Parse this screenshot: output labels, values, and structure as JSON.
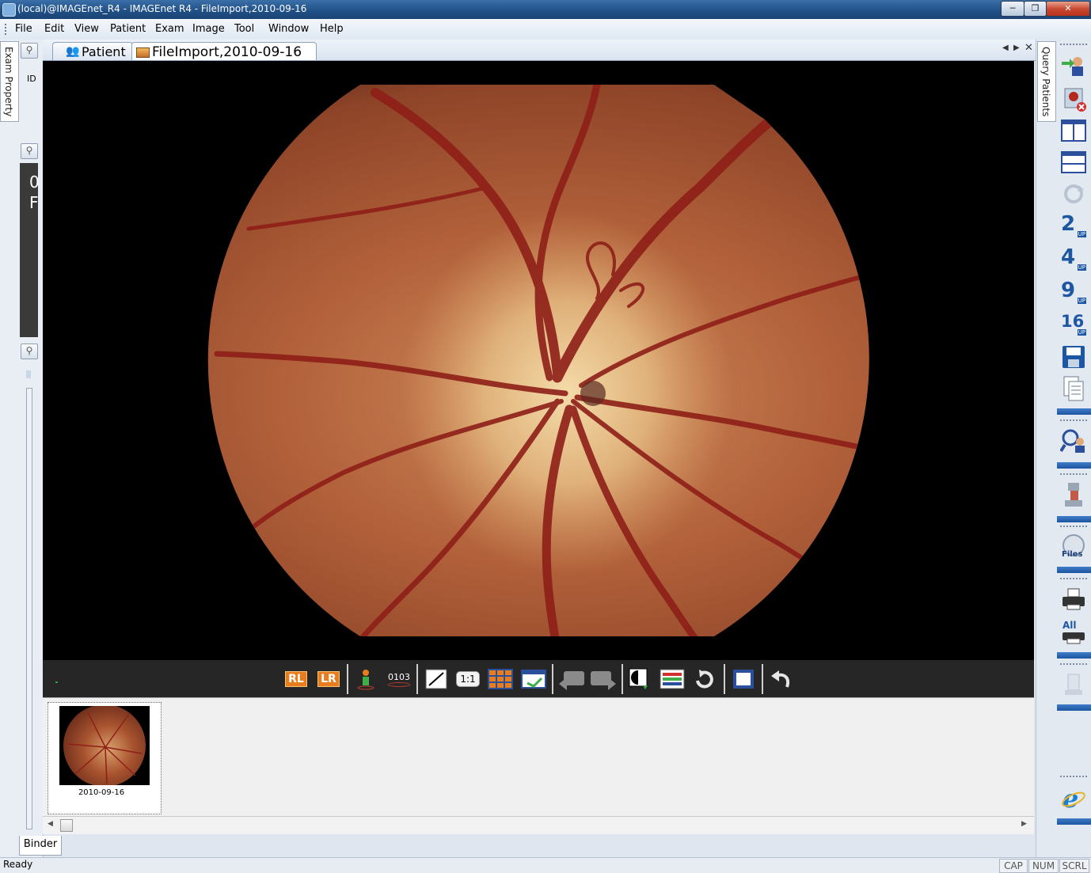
{
  "window": {
    "title": "(local)@IMAGEnet_R4 - IMAGEnet R4 - FileImport,2010-09-16",
    "controls": [
      "minimize-icon",
      "maximize-icon",
      "close-icon"
    ]
  },
  "menubar": {
    "items": [
      {
        "label": "File"
      },
      {
        "label": "Edit"
      },
      {
        "label": "View"
      },
      {
        "label": "Patient"
      },
      {
        "label": "Exam"
      },
      {
        "label": "Image"
      },
      {
        "label": "Tool"
      },
      {
        "label": "Window"
      },
      {
        "label": "Help"
      }
    ]
  },
  "left_dock": {
    "exam_property_tab": "Exam Property",
    "id_label": "ID",
    "info_line_1": "0",
    "info_line_2": "F"
  },
  "document_tabs": [
    {
      "label": "Patient",
      "icon": "patient-icon"
    },
    {
      "label": "FileImport,2010-09-16",
      "icon": "image-icon",
      "active": true
    }
  ],
  "tab_nav": {
    "icons": [
      "tab-prev-icon",
      "tab-next-icon",
      "tab-close-icon"
    ]
  },
  "toolbar": {
    "rl_label": "RL",
    "lr_label": "LR",
    "counter_label": "0103",
    "one_to_one_label": "1:1",
    "icons": [
      "rl-flip-icon",
      "lr-flip-icon",
      "figure-icon",
      "counter-icon",
      "measure-line-icon",
      "actual-size-icon",
      "grid-layout-icon",
      "monitor-sync-icon",
      "previous-image-icon",
      "next-image-icon",
      "contrast-icon",
      "color-channel-icon",
      "rotate-icon",
      "fit-window-icon",
      "undo-icon"
    ]
  },
  "binder": {
    "thumbnails": [
      {
        "label": "2010-09-16"
      }
    ],
    "tab_label": "Binder"
  },
  "right_dock": {
    "query_tab": "Query Patients",
    "badges": {
      "two": "2",
      "four": "4",
      "nine": "9",
      "sixteen": "16",
      "up": "UP",
      "files": "Files",
      "all": "All"
    },
    "icons": [
      "patient-transfer-icon",
      "delete-patient-icon",
      "layout-vertical-icon",
      "layout-horizontal-icon",
      "refresh-icon",
      "two-up-icon",
      "four-up-icon",
      "nine-up-icon",
      "sixteen-up-icon",
      "save-icon",
      "copy-icon",
      "search-patient-icon",
      "capture-device-icon",
      "files-icon",
      "print-icon",
      "print-all-icon",
      "export-icon",
      "internet-explorer-icon"
    ]
  },
  "statusbar": {
    "status": "Ready",
    "indicators": [
      "CAP",
      "NUM",
      "SCRL"
    ]
  },
  "colors": {
    "title_bar": "#204f86",
    "viewer_background": "#000000",
    "fundus_base": "#a34e2e",
    "vessel": "#8e1f18",
    "disc": "#e7c28a",
    "toolbar_bg": "#262626",
    "orange_badge": "#e77d1c",
    "dock_accent": "#1d56a3"
  }
}
